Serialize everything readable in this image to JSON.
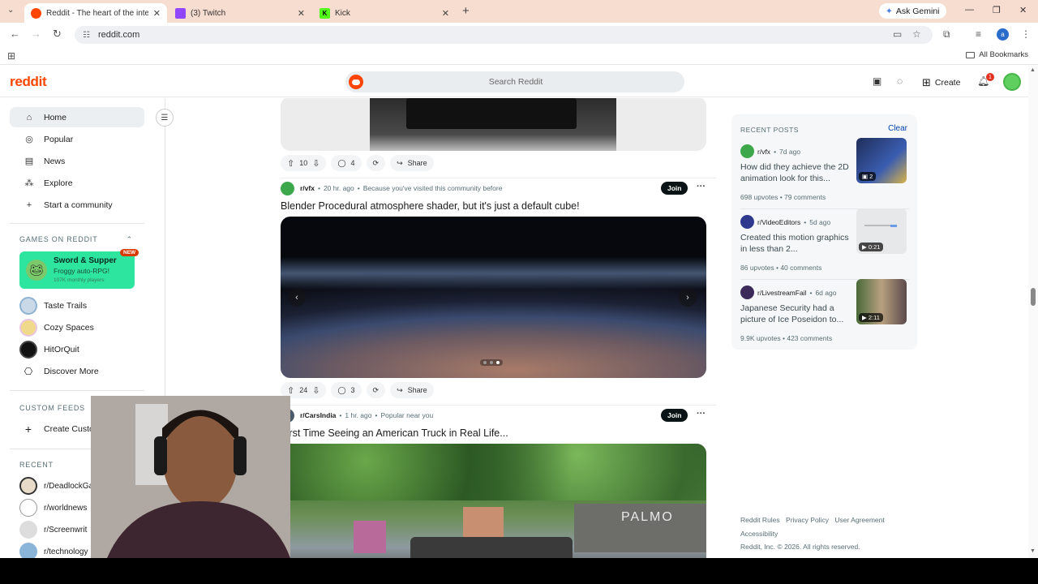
{
  "browser": {
    "tabs": [
      {
        "title": "Reddit - The heart of the intern",
        "favicon_color": "#ff4500"
      },
      {
        "title": "(3) Twitch",
        "favicon_color": "#9146ff"
      },
      {
        "title": "Kick",
        "favicon_color": "#53fc18"
      }
    ],
    "ask_gemini": "Ask Gemini",
    "url": "reddit.com",
    "all_bookmarks": "All Bookmarks"
  },
  "header": {
    "logo": "reddit",
    "search_placeholder": "Search Reddit",
    "create_label": "Create",
    "notification_count": "1"
  },
  "sidebar": {
    "nav": [
      {
        "label": "Home",
        "icon": "home-icon"
      },
      {
        "label": "Popular",
        "icon": "popular-icon"
      },
      {
        "label": "News",
        "icon": "news-icon"
      },
      {
        "label": "Explore",
        "icon": "explore-icon"
      },
      {
        "label": "Start a community",
        "icon": "plus-icon"
      }
    ],
    "games_heading": "GAMES ON REDDIT",
    "featured_game": {
      "title": "Sword & Supper",
      "subtitle": "Froggy auto-RPG!",
      "players": "107K monthly players",
      "badge": "NEW"
    },
    "games": [
      "Taste Trails",
      "Cozy Spaces",
      "HitOrQuit",
      "Discover More"
    ],
    "custom_feeds_heading": "CUSTOM FEEDS",
    "create_custom_feed": "Create Custom Feed",
    "recent_heading": "RECENT",
    "recent": [
      "r/DeadlockGame",
      "r/worldnews",
      "r/Screenwrit",
      "r/technology"
    ]
  },
  "feed": {
    "post0_actions": {
      "votes": "10",
      "comments": "4",
      "share": "Share"
    },
    "post1": {
      "subreddit": "r/vfx",
      "time": "20 hr. ago",
      "reason": "Because you've visited this community before",
      "join": "Join",
      "title": "Blender Procedural atmosphere shader, but it's just a default cube!",
      "votes": "24",
      "comments": "3",
      "share": "Share"
    },
    "post2": {
      "subreddit": "r/CarsIndia",
      "time": "1 hr. ago",
      "reason": "Popular near you",
      "join": "Join",
      "title": "First Time Seeing an American Truck in Real Life...",
      "sign_text": "PALMO"
    }
  },
  "recent_posts": {
    "heading": "RECENT POSTS",
    "clear": "Clear",
    "items": [
      {
        "subreddit": "r/vfx",
        "age": "7d ago",
        "title": "How did they achieve the 2D animation look for this...",
        "upvotes": "698 upvotes",
        "comments": "79 comments",
        "badge": "2"
      },
      {
        "subreddit": "r/VideoEditors",
        "age": "5d ago",
        "title": "Created this motion graphics in less than 2...",
        "upvotes": "86 upvotes",
        "comments": "40 comments",
        "badge": "0:21"
      },
      {
        "subreddit": "r/LivestreamFail",
        "age": "6d ago",
        "title": "Japanese Security had a picture of Ice Poseidon to...",
        "upvotes": "9.9K upvotes",
        "comments": "423 comments",
        "badge": "2:11"
      }
    ]
  },
  "footer": {
    "links": [
      "Reddit Rules",
      "Privacy Policy",
      "User Agreement"
    ],
    "accessibility": "Accessibility",
    "copyright": "Reddit, Inc. © 2026. All rights reserved."
  }
}
